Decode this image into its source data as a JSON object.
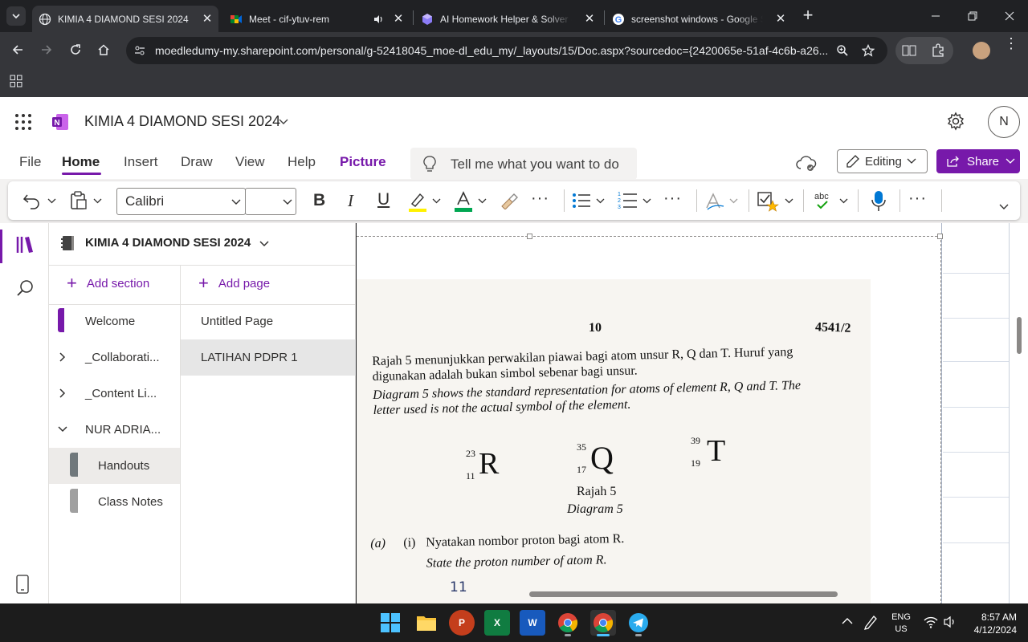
{
  "browser": {
    "tabs": [
      {
        "title": "KIMIA 4 DIAMOND SESI 2024",
        "icon": "onenote-icon"
      },
      {
        "title": "Meet - cif-ytuv-rem",
        "icon": "meet-icon"
      },
      {
        "title": "AI Homework Helper & Solver -",
        "icon": "ai-helper-icon"
      },
      {
        "title": "screenshot windows - Google S",
        "icon": "google-icon"
      }
    ],
    "url": "moedledumy-my.sharepoint.com/personal/g-52418045_moe-dl_edu_my/_layouts/15/Doc.aspx?sourcedoc={2420065e-51af-4c6b-a26..."
  },
  "onenote": {
    "notebook_title": "KIMIA 4 DIAMOND SESI 2024",
    "avatar_initial": "N",
    "menu": [
      "File",
      "Home",
      "Insert",
      "Draw",
      "View",
      "Help",
      "Picture"
    ],
    "tell_me": "Tell me what you want to do",
    "editing_label": "Editing",
    "share_label": "Share",
    "font_name": "Calibri",
    "font_size": "",
    "colors": {
      "accent": "#7719aa",
      "highlight": "#fff100",
      "font_color": "#00a651"
    }
  },
  "nav": {
    "notebook": "KIMIA 4 DIAMOND SESI 2024",
    "add_section": "Add section",
    "add_page": "Add page",
    "sections": [
      {
        "label": "Welcome",
        "type": "section",
        "color": "#7719aa"
      },
      {
        "label": "_Collaborati...",
        "type": "group",
        "expanded": false
      },
      {
        "label": "_Content Li...",
        "type": "group",
        "expanded": false
      },
      {
        "label": "NUR ADRIA...",
        "type": "group",
        "expanded": true
      },
      {
        "label": "Handouts",
        "type": "section",
        "color": "#70787c",
        "selected": true
      },
      {
        "label": "Class Notes",
        "type": "section",
        "color": "#a0a0a0"
      }
    ],
    "pages": [
      {
        "label": "Untitled Page",
        "selected": false
      },
      {
        "label": "LATIHAN PDPR 1",
        "selected": true
      }
    ]
  },
  "paper": {
    "page_number": "10",
    "paper_code": "4541/2",
    "ms_line1": "Rajah 5 menunjukkan perwakilan piawai bagi atom unsur R, Q dan T. Huruf yang",
    "ms_line2": "digunakan adalah bukan simbol sebenar bagi unsur.",
    "en_line1": "Diagram 5 shows the standard representation for atoms of element R, Q and T. The",
    "en_line2": "letter used is not the actual symbol of the element.",
    "atoms": [
      {
        "mass": "23",
        "proton": "11",
        "symbol": "R"
      },
      {
        "mass": "35",
        "proton": "17",
        "symbol": "Q"
      },
      {
        "mass": "39",
        "proton": "19",
        "symbol": "T"
      }
    ],
    "caption_ms": "Rajah 5",
    "caption_en": "Diagram 5",
    "q_part": "(a)",
    "q_sub": "(i)",
    "q_ms": "Nyatakan nombor proton bagi atom R.",
    "q_en": "State the proton number of atom R.",
    "answer_partial": "11"
  },
  "taskbar": {
    "lang1": "ENG",
    "lang2": "US",
    "time": "8:57 AM",
    "date": "4/12/2024"
  }
}
